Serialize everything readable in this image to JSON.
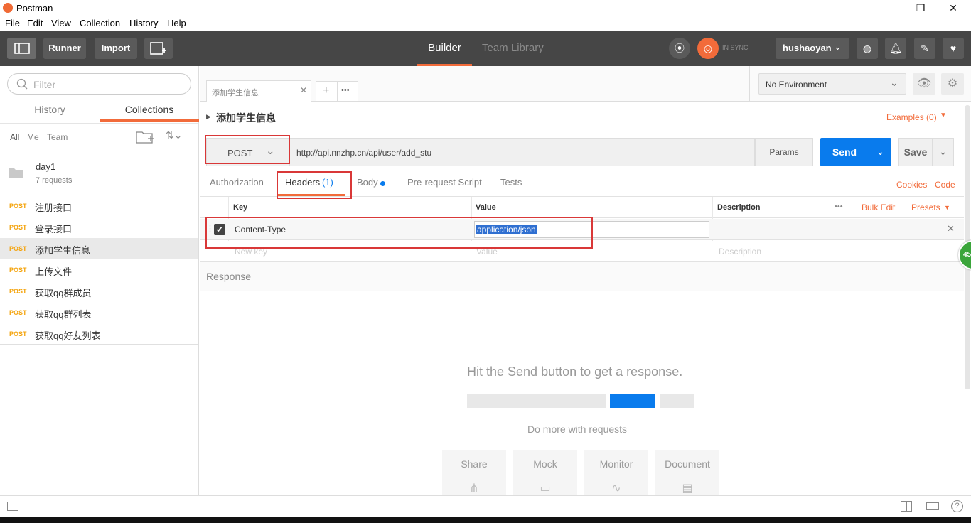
{
  "window": {
    "title": "Postman",
    "minimize": "—",
    "restore": "❐",
    "close": "✕"
  },
  "menu": [
    "File",
    "Edit",
    "View",
    "Collection",
    "History",
    "Help"
  ],
  "toolbar": {
    "runner": "Runner",
    "import": "Import",
    "builder": "Builder",
    "team_library": "Team Library",
    "sync_status": "IN SYNC",
    "user": "hushaoyan"
  },
  "sidebar": {
    "filter_placeholder": "Filter",
    "tabs": [
      "History",
      "Collections"
    ],
    "filters": [
      "All",
      "Me",
      "Team"
    ],
    "collection": {
      "name": "day1",
      "count": "7 requests"
    },
    "requests": [
      {
        "method": "POST",
        "name": "注册接口"
      },
      {
        "method": "POST",
        "name": "登录接口"
      },
      {
        "method": "POST",
        "name": "添加学生信息"
      },
      {
        "method": "POST",
        "name": "上传文件"
      },
      {
        "method": "POST",
        "name": "获取qq群成员"
      },
      {
        "method": "POST",
        "name": "获取qq群列表"
      },
      {
        "method": "POST",
        "name": "获取qq好友列表"
      }
    ]
  },
  "request_tab": {
    "label": "添加学生信息",
    "close": "✕",
    "add": "+",
    "more": "•••"
  },
  "environment": {
    "selected": "No Environment"
  },
  "request": {
    "title": "添加学生信息",
    "examples": "Examples (0)",
    "method": "POST",
    "url": "http://api.nnzhp.cn/api/user/add_stu",
    "params": "Params",
    "send": "Send",
    "save": "Save"
  },
  "subtabs": {
    "authorization": "Authorization",
    "headers": "Headers",
    "headers_count": "(1)",
    "body": "Body",
    "prerequest": "Pre-request Script",
    "tests": "Tests",
    "cookies": "Cookies",
    "code": "Code"
  },
  "headers_table": {
    "col_key": "Key",
    "col_value": "Value",
    "col_description": "Description",
    "more": "•••",
    "bulk_edit": "Bulk Edit",
    "presets": "Presets",
    "row": {
      "key": "Content-Type",
      "value": "application/json"
    },
    "new_key_placeholder": "New key",
    "value_placeholder": "Value",
    "description_placeholder": "Description",
    "remove": "✕"
  },
  "response": {
    "label": "Response",
    "hint": "Hit the Send button to get a response.",
    "do_more": "Do more with requests",
    "cards": [
      "Share",
      "Mock",
      "Monitor",
      "Document"
    ]
  },
  "badge": "45",
  "colors": {
    "accent": "#f26b3a",
    "send": "#097bed",
    "toolbar": "#464646",
    "method": "#f4a40e",
    "highlight_box": "#d93838"
  }
}
